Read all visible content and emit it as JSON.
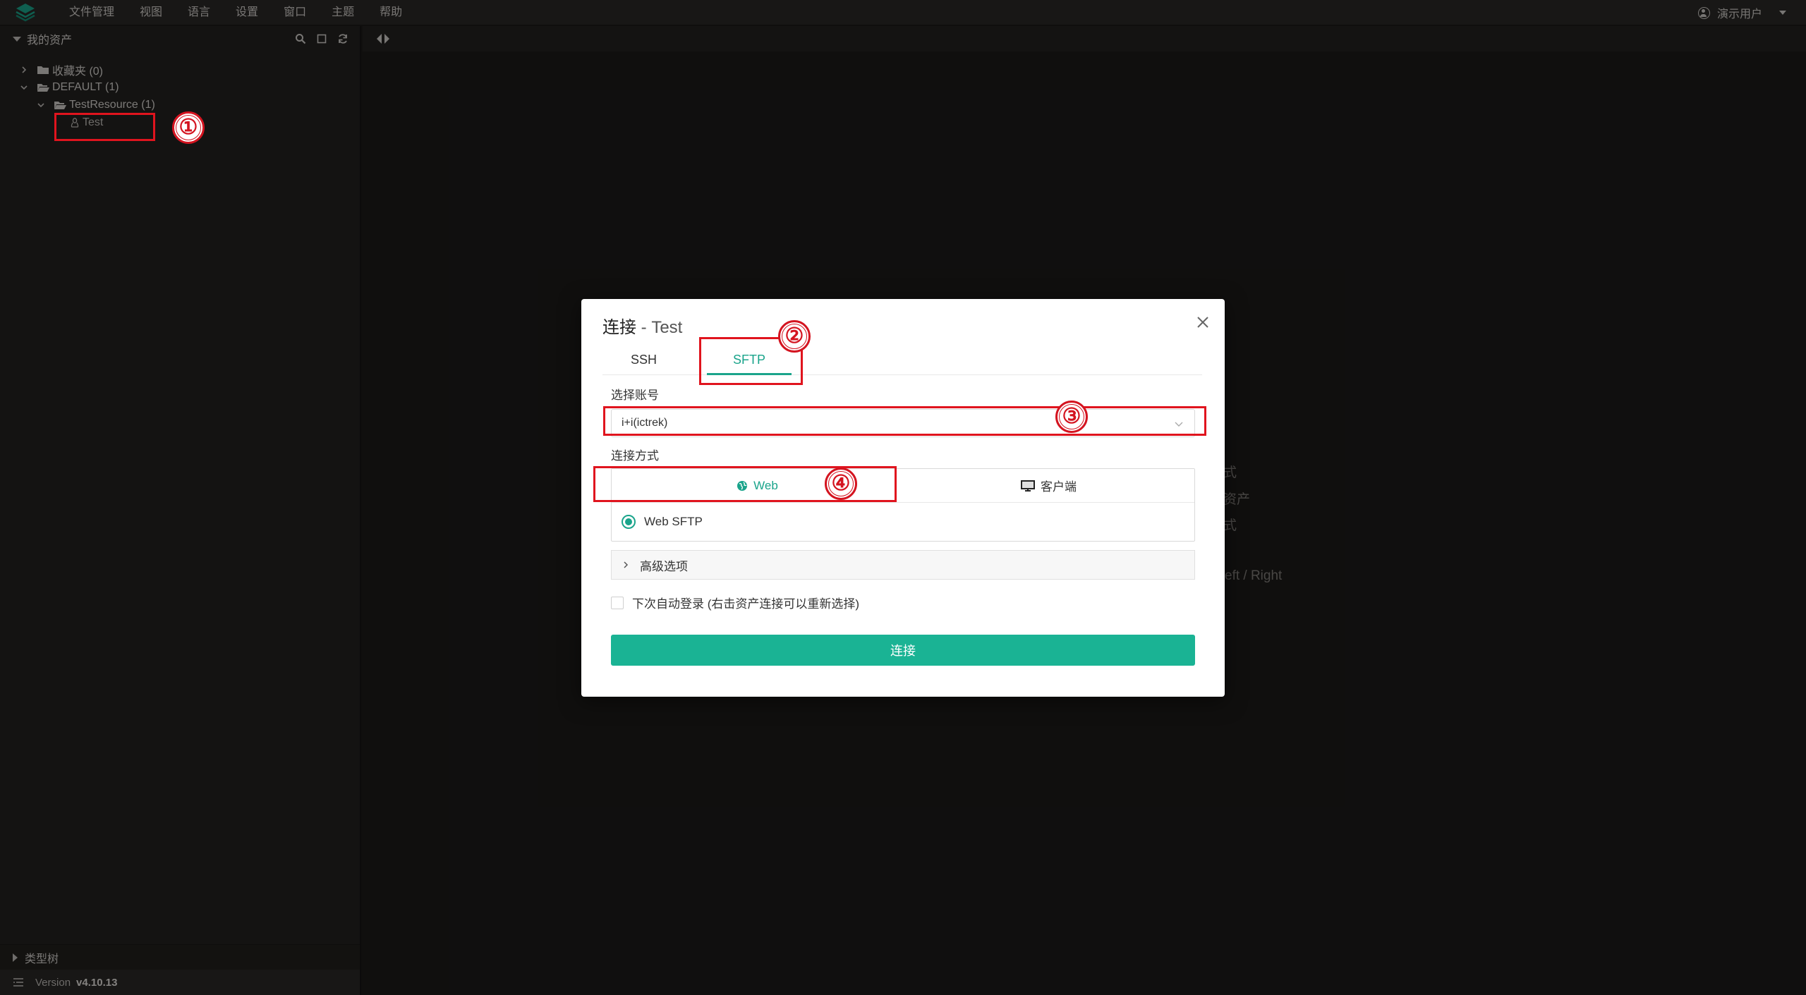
{
  "menubar": {
    "items": [
      "文件管理",
      "视图",
      "语言",
      "设置",
      "窗口",
      "主题",
      "帮助"
    ],
    "user": "演示用户"
  },
  "sidebar": {
    "title": "我的资产",
    "tree": {
      "favorites": "收藏夹 (0)",
      "default": "DEFAULT (1)",
      "resource": "TestResource (1)",
      "asset": "Test"
    },
    "type_tree": "类型树",
    "version_label": "Version",
    "version": "v4.10.13"
  },
  "background_hints": [
    "式",
    "资产",
    "式",
    "eft / Right"
  ],
  "modal": {
    "title": "连接",
    "subtitle": " - Test",
    "tabs": [
      "SSH",
      "SFTP"
    ],
    "active_tab": "SFTP",
    "account_label": "选择账号",
    "account_value": "i+i(ictrek)",
    "method_label": "连接方式",
    "method_web": "Web",
    "method_client": "客户端",
    "radio_option": "Web SFTP",
    "advanced": "高级选项",
    "autologin": "下次自动登录 (右击资产连接可以重新选择)",
    "connect": "连接"
  },
  "annotations": [
    "①",
    "②",
    "③",
    "④"
  ],
  "colors": {
    "accent": "#1aa48b",
    "button": "#1ab394",
    "annotation": "#e0141e"
  }
}
